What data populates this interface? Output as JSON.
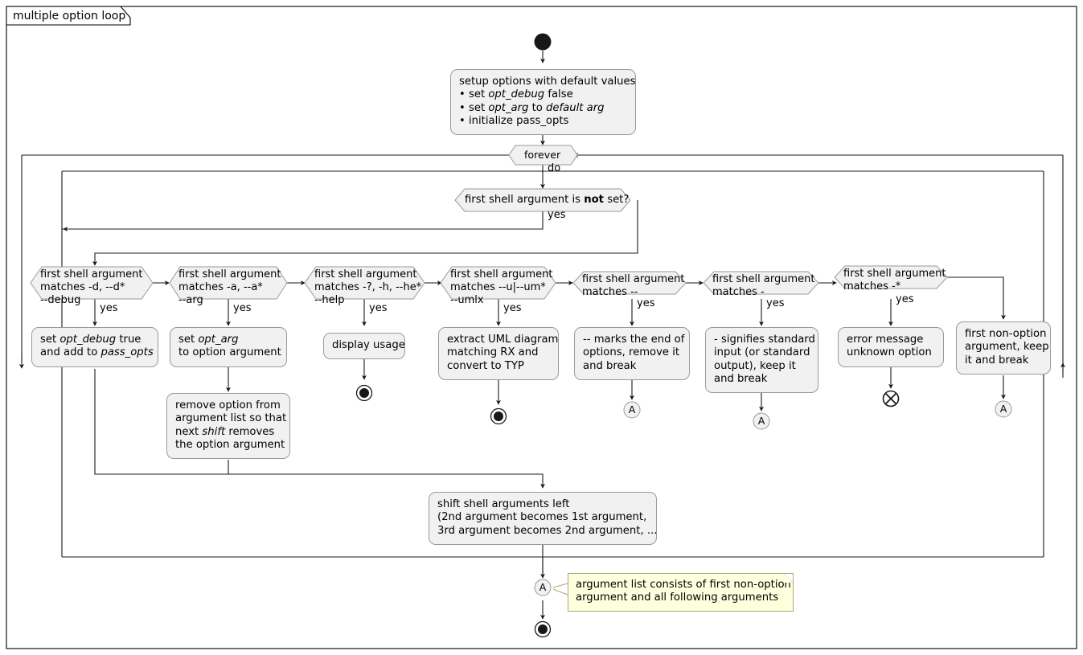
{
  "diagram": {
    "frame_label": "multiple option loop",
    "type": "uml-activity-diagram",
    "colors": {
      "node_fill": "#F1F1F1",
      "node_border": "#9A9A9A",
      "note_fill": "#FEFFDD",
      "note_border": "#A9A97A",
      "line": "#181818",
      "frame_border": "#000000"
    }
  },
  "nodes": {
    "start": {
      "name": "start-node",
      "kind": "initial"
    },
    "setup": {
      "name": "setup-options-activity",
      "kind": "activity",
      "title": "setup options with default values",
      "bullets": [
        "set opt_debug false",
        "set opt_arg to default arg",
        "initialize pass_opts"
      ],
      "text": "setup options with default values\n• set opt_debug false\n• set opt_arg to default arg\n• initialize pass_opts"
    },
    "forever": {
      "name": "forever-loop-node",
      "kind": "loop",
      "label": "forever",
      "body_label": "do"
    },
    "arg_not_set": {
      "name": "decision-first-arg-not-set",
      "kind": "decision",
      "label": "first shell argument is not set?",
      "label_pre": "first shell argument is ",
      "label_bold": "not",
      "label_post": " set?",
      "yes_label": "yes"
    },
    "dec_debug": {
      "name": "decision-matches-debug",
      "kind": "decision",
      "label": "first shell argument\nmatches -d, --d*\n--debug",
      "yes_label": "yes"
    },
    "act_debug": {
      "name": "activity-set-opt-debug",
      "kind": "activity",
      "text": "set opt_debug true\nand add to pass_opts"
    },
    "dec_arg": {
      "name": "decision-matches-arg",
      "kind": "decision",
      "label": "first shell argument\nmatches -a, --a*\n--arg",
      "yes_label": "yes"
    },
    "act_arg": {
      "name": "activity-set-opt-arg",
      "kind": "activity",
      "text": "set opt_arg\nto option argument"
    },
    "act_remove_option": {
      "name": "activity-remove-option",
      "kind": "activity",
      "text": "remove option from\nargument list so that\nnext shift removes\nthe option argument"
    },
    "dec_help": {
      "name": "decision-matches-help",
      "kind": "decision",
      "label": "first shell argument\nmatches -?, -h, --he*\n--help",
      "yes_label": "yes"
    },
    "act_usage": {
      "name": "activity-display-usage",
      "kind": "activity",
      "text": "display usage"
    },
    "dec_uml": {
      "name": "decision-matches-uml",
      "kind": "decision",
      "label": "first shell argument\nmatches --u|--um*\n--umlx",
      "yes_label": "yes"
    },
    "act_uml": {
      "name": "activity-extract-uml",
      "kind": "activity",
      "text": "extract UML diagram\nmatching RX and\nconvert to TYP"
    },
    "dec_ddash": {
      "name": "decision-matches-double-dash",
      "kind": "decision",
      "label": "first shell argument\nmatches --",
      "yes_label": "yes"
    },
    "act_ddash": {
      "name": "activity-end-of-options",
      "kind": "activity",
      "text": "-- marks the end of\noptions, remove it\nand break"
    },
    "dec_dash": {
      "name": "decision-matches-single-dash",
      "kind": "decision",
      "label": "first shell argument\nmatches -",
      "yes_label": "yes"
    },
    "act_dash": {
      "name": "activity-standard-input",
      "kind": "activity",
      "text": "- signifies standard\ninput (or standard\noutput), keep it\nand break"
    },
    "dec_unknown": {
      "name": "decision-matches-dash-star",
      "kind": "decision",
      "label": "first shell argument\nmatches -*",
      "yes_label": "yes"
    },
    "act_error": {
      "name": "activity-error-unknown-option",
      "kind": "activity",
      "text": "error message\nunknown option"
    },
    "act_nonoption": {
      "name": "activity-first-non-option",
      "kind": "activity",
      "text": "first non-option\nargument, keep\nit and break"
    },
    "act_shift": {
      "name": "activity-shift-shell-arguments",
      "kind": "activity",
      "text": "shift shell arguments left\n(2nd argument becomes 1st argument,\n3rd argument becomes 2nd argument, ..."
    },
    "connector_a_ddash": {
      "name": "connector-a",
      "kind": "connector",
      "label": "A"
    },
    "connector_a_dash": {
      "name": "connector-a",
      "kind": "connector",
      "label": "A"
    },
    "connector_a_nonoption": {
      "name": "connector-a",
      "kind": "connector",
      "label": "A"
    },
    "connector_a_join": {
      "name": "connector-a-join",
      "kind": "connector",
      "label": "A"
    },
    "end_usage": {
      "name": "final-node-usage",
      "kind": "final"
    },
    "end_uml": {
      "name": "final-node-uml",
      "kind": "final"
    },
    "flow_final_error": {
      "name": "flow-final-node-error",
      "kind": "flow-final"
    },
    "end_main": {
      "name": "final-node-main",
      "kind": "final"
    }
  },
  "note": {
    "name": "note-argument-list",
    "text": "argument list consists of first non-option\nargument and all following arguments"
  }
}
